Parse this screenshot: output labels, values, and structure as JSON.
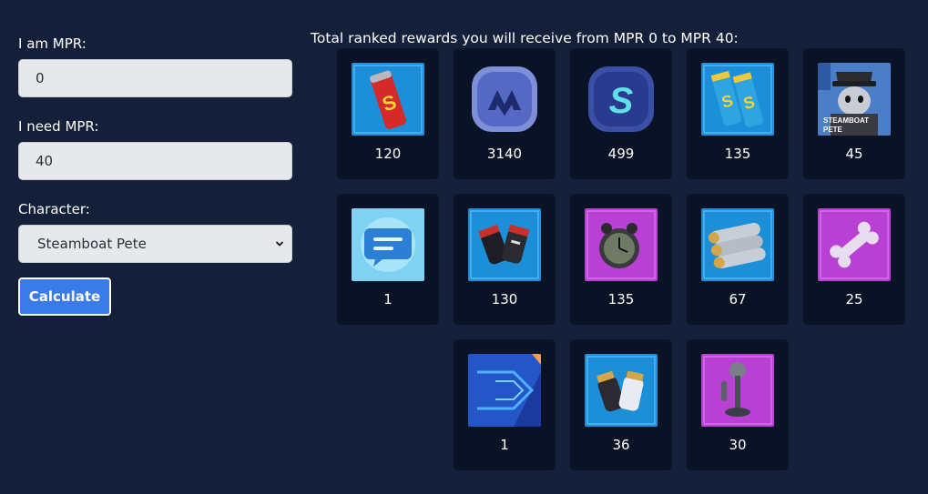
{
  "form": {
    "current_label": "I am MPR:",
    "current_value": "0",
    "target_label": "I need MPR:",
    "target_value": "40",
    "character_label": "Character:",
    "character_value": "Steamboat Pete",
    "calculate_label": "Calculate"
  },
  "rewards_title": "Total ranked rewards you will receive from MPR 0 to MPR 40:",
  "rewards": [
    {
      "quantity": "120",
      "icon": "red-energy-can-icon"
    },
    {
      "quantity": "3140",
      "icon": "blue-currency-coin-icon"
    },
    {
      "quantity": "499",
      "icon": "cyan-currency-coin-icon"
    },
    {
      "quantity": "135",
      "icon": "double-energy-can-icon"
    },
    {
      "quantity": "45",
      "icon": "steamboat-pete-portrait-icon",
      "portrait_text": "STEAMBOAT PETE"
    },
    {
      "quantity": "1",
      "icon": "chat-bubble-icon"
    },
    {
      "quantity": "130",
      "icon": "gloves-icon"
    },
    {
      "quantity": "135",
      "icon": "alarm-clock-icon"
    },
    {
      "quantity": "67",
      "icon": "scroll-bundle-icon"
    },
    {
      "quantity": "25",
      "icon": "bone-icon"
    },
    {
      "quantity": "1",
      "icon": "banner-card-icon"
    },
    {
      "quantity": "36",
      "icon": "white-gloves-icon"
    },
    {
      "quantity": "30",
      "icon": "candlestick-phone-icon"
    }
  ],
  "colors": {
    "background": "#141f3a",
    "card": "#0a1326",
    "button": "#3a7bea",
    "input": "#e7e8ec"
  }
}
